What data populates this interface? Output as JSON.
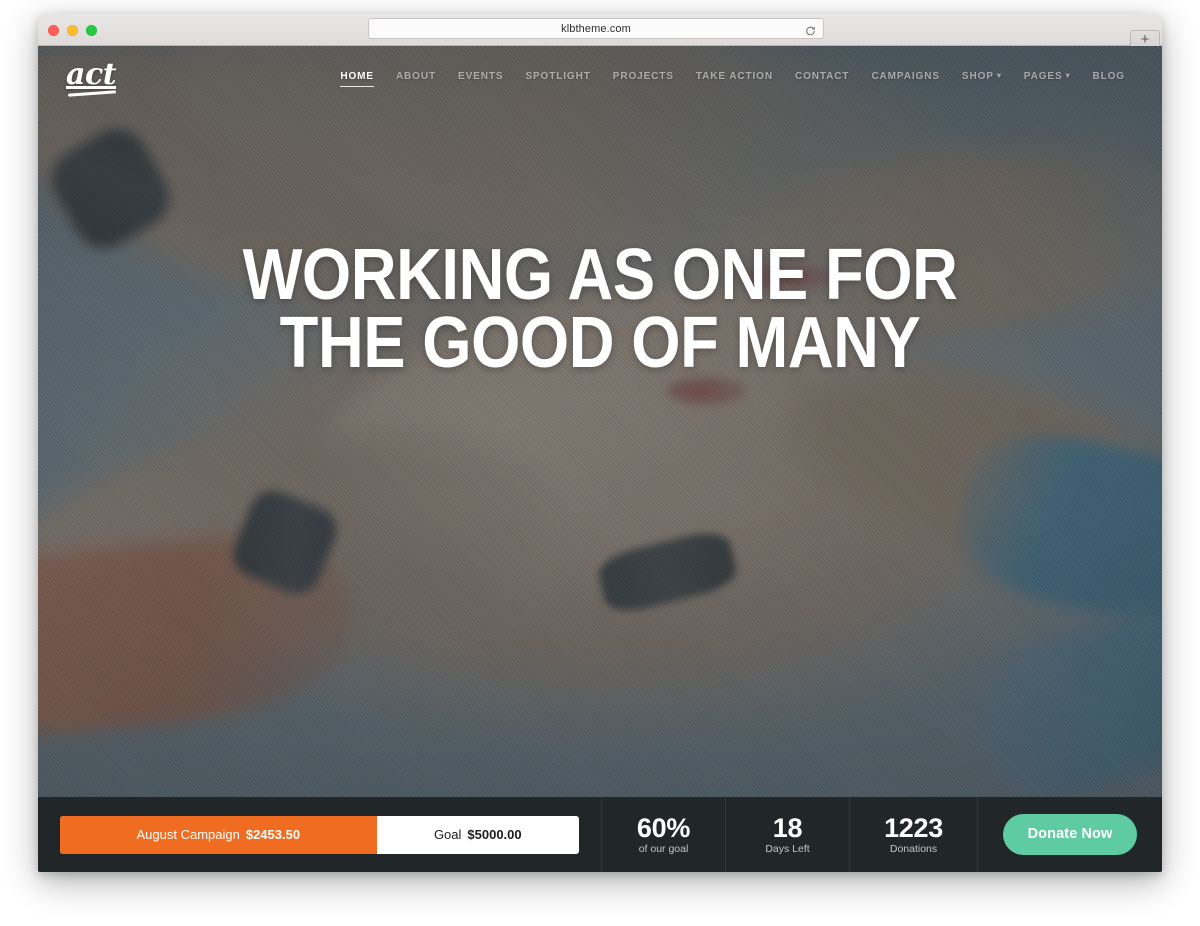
{
  "browser": {
    "url": "klbtheme.com",
    "reload_icon": "reload-icon",
    "newtab_label": "+",
    "traffic_lights": [
      "close",
      "minimize",
      "maximize"
    ]
  },
  "site": {
    "logo_text": "act",
    "nav": [
      {
        "label": "HOME",
        "active": true,
        "dropdown": false
      },
      {
        "label": "ABOUT",
        "active": false,
        "dropdown": false
      },
      {
        "label": "EVENTS",
        "active": false,
        "dropdown": false
      },
      {
        "label": "SPOTLIGHT",
        "active": false,
        "dropdown": false
      },
      {
        "label": "PROJECTS",
        "active": false,
        "dropdown": false
      },
      {
        "label": "TAKE ACTION",
        "active": false,
        "dropdown": false
      },
      {
        "label": "CONTACT",
        "active": false,
        "dropdown": false
      },
      {
        "label": "CAMPAIGNS",
        "active": false,
        "dropdown": false
      },
      {
        "label": "SHOP",
        "active": false,
        "dropdown": true
      },
      {
        "label": "PAGES",
        "active": false,
        "dropdown": true
      },
      {
        "label": "BLOG",
        "active": false,
        "dropdown": false
      }
    ],
    "caret_glyph": "▾"
  },
  "hero": {
    "title_line1": "WORKING AS ONE FOR",
    "title_line2": "THE GOOD OF MANY",
    "image_description": "overhead photo of many hands and forearms stacked together in a team huddle"
  },
  "campaign_bar": {
    "progress": {
      "campaign_label": "August Campaign",
      "raised_amount": "$2453.50",
      "goal_label": "Goal",
      "goal_amount": "$5000.00",
      "fill_percent": 61
    },
    "stats": [
      {
        "value": "60%",
        "label": "of our goal"
      },
      {
        "value": "18",
        "label": "Days Left"
      },
      {
        "value": "1223",
        "label": "Donations"
      }
    ],
    "donate_label": "Donate Now"
  },
  "colors": {
    "accent_orange": "#ef6c20",
    "accent_green": "#5ecba2",
    "bar_background": "#212629",
    "text_white": "#ffffff"
  }
}
